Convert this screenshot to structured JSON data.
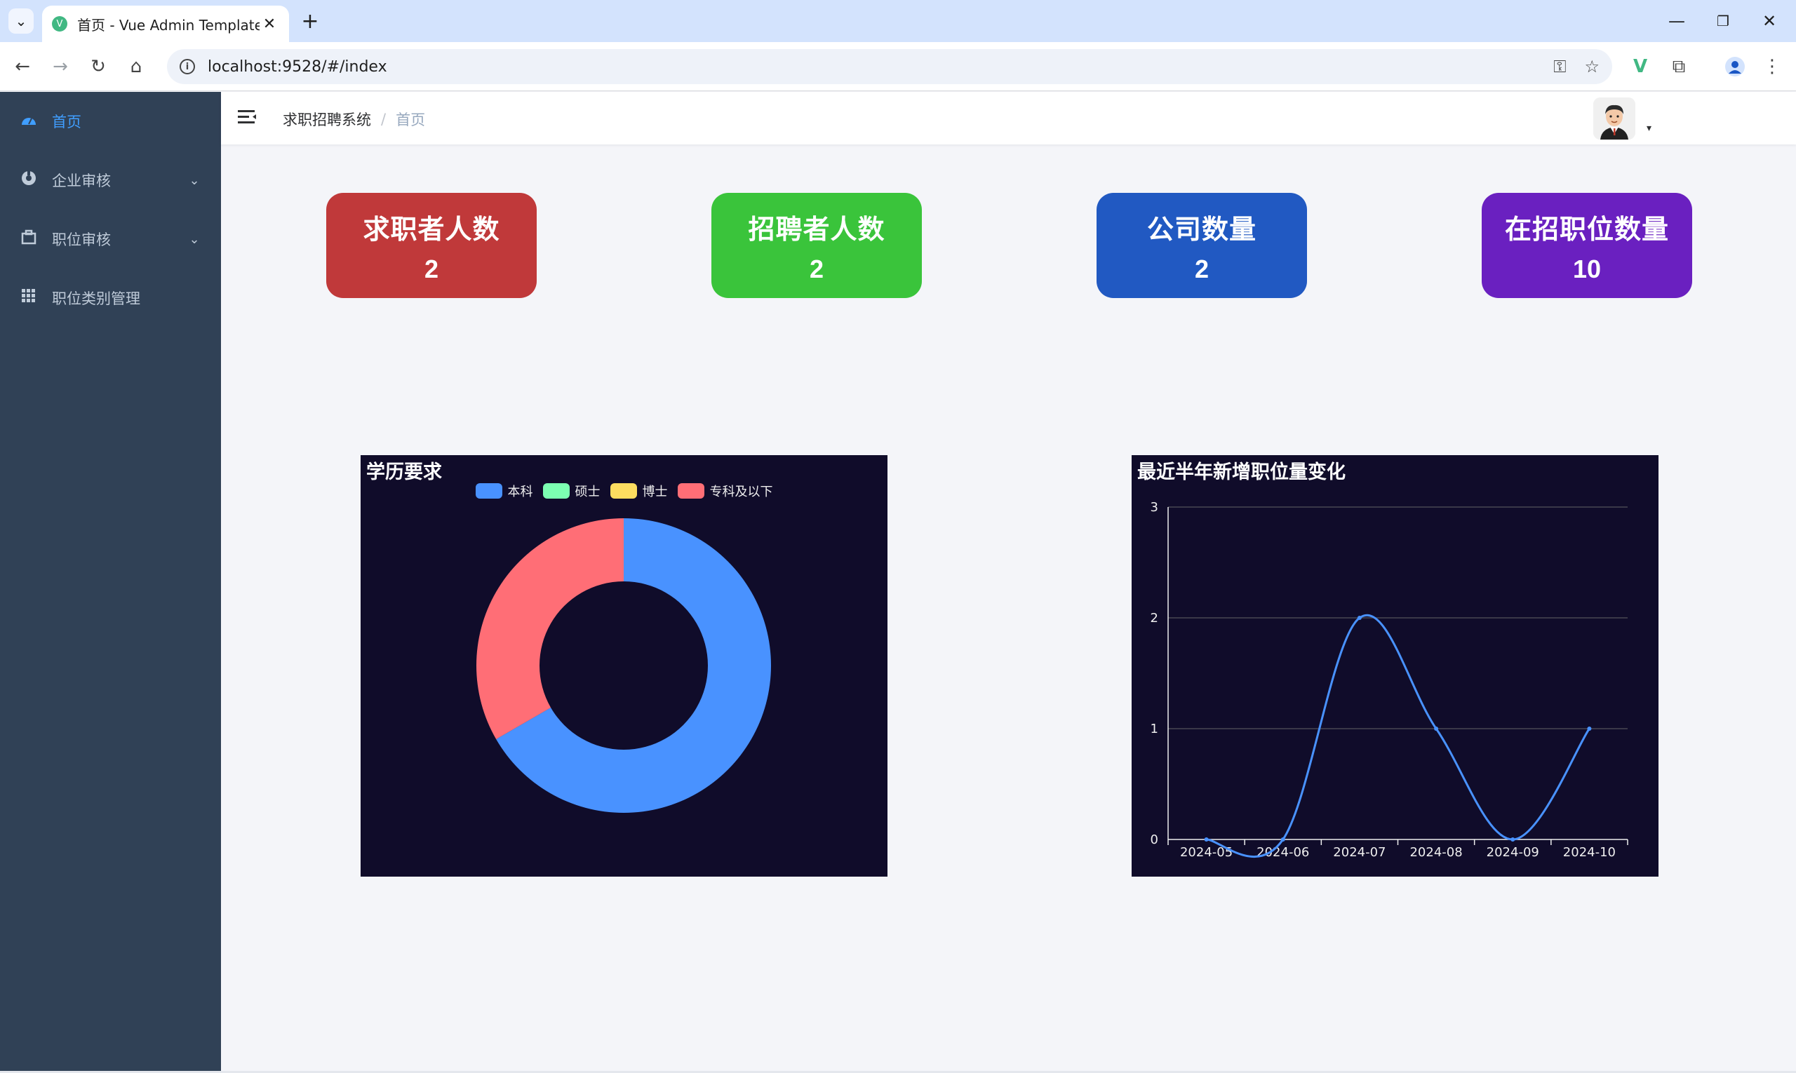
{
  "browser": {
    "tab_title": "首页 - Vue Admin Template",
    "favicon_letter": "V",
    "url": "localhost:9528/#/index",
    "icons": [
      "chevron-down-icon",
      "close-icon",
      "plus-icon",
      "minimize-icon",
      "restore-icon",
      "back-icon",
      "forward-icon",
      "reload-icon",
      "home-icon",
      "info-icon",
      "key-icon",
      "star-icon",
      "vue-devtools-icon",
      "extensions-icon",
      "profile-icon",
      "more-icon"
    ]
  },
  "sidebar": {
    "items": [
      {
        "label": "首页",
        "icon": "dashboard-icon",
        "active": true
      },
      {
        "label": "企业审核",
        "icon": "company-icon",
        "has_children": true
      },
      {
        "label": "职位审核",
        "icon": "briefcase-icon",
        "has_children": true
      },
      {
        "label": "职位类别管理",
        "icon": "grid-icon"
      }
    ],
    "colors": {
      "background": "#304156",
      "text": "#bfcbd9",
      "active": "#409eff"
    }
  },
  "navbar": {
    "breadcrumb": [
      "求职招聘系统",
      "首页"
    ],
    "separator": "/"
  },
  "stats": [
    {
      "label": "求职者人数",
      "value": "2",
      "color": "#c0393a"
    },
    {
      "label": "招聘者人数",
      "value": "2",
      "color": "#3ac43b"
    },
    {
      "label": "公司数量",
      "value": "2",
      "color": "#2159c2"
    },
    {
      "label": "在招职位数量",
      "value": "10",
      "color": "#6a20c0"
    }
  ],
  "chart_data": [
    {
      "type": "pie",
      "donut": true,
      "title": "学历要求",
      "legend_position": "top-center",
      "categories": [
        "本科",
        "硕士",
        "博士",
        "专科及以下"
      ],
      "values": [
        2,
        0,
        0,
        1
      ],
      "colors": [
        "#4992ff",
        "#7cffb2",
        "#fddd60",
        "#ff6e76"
      ],
      "background": "#100c2a"
    },
    {
      "type": "line",
      "smooth": true,
      "title": "最近半年新增职位量变化",
      "x": [
        "2024-05",
        "2024-06",
        "2024-07",
        "2024-08",
        "2024-09",
        "2024-10"
      ],
      "series": [
        {
          "values": [
            0,
            0,
            2,
            1,
            0,
            1
          ]
        }
      ],
      "ylim": [
        0,
        3
      ],
      "yticks": [
        "0",
        "1",
        "2",
        "3"
      ],
      "grid": true,
      "color": "#4992ff",
      "background": "#100c2a"
    }
  ]
}
